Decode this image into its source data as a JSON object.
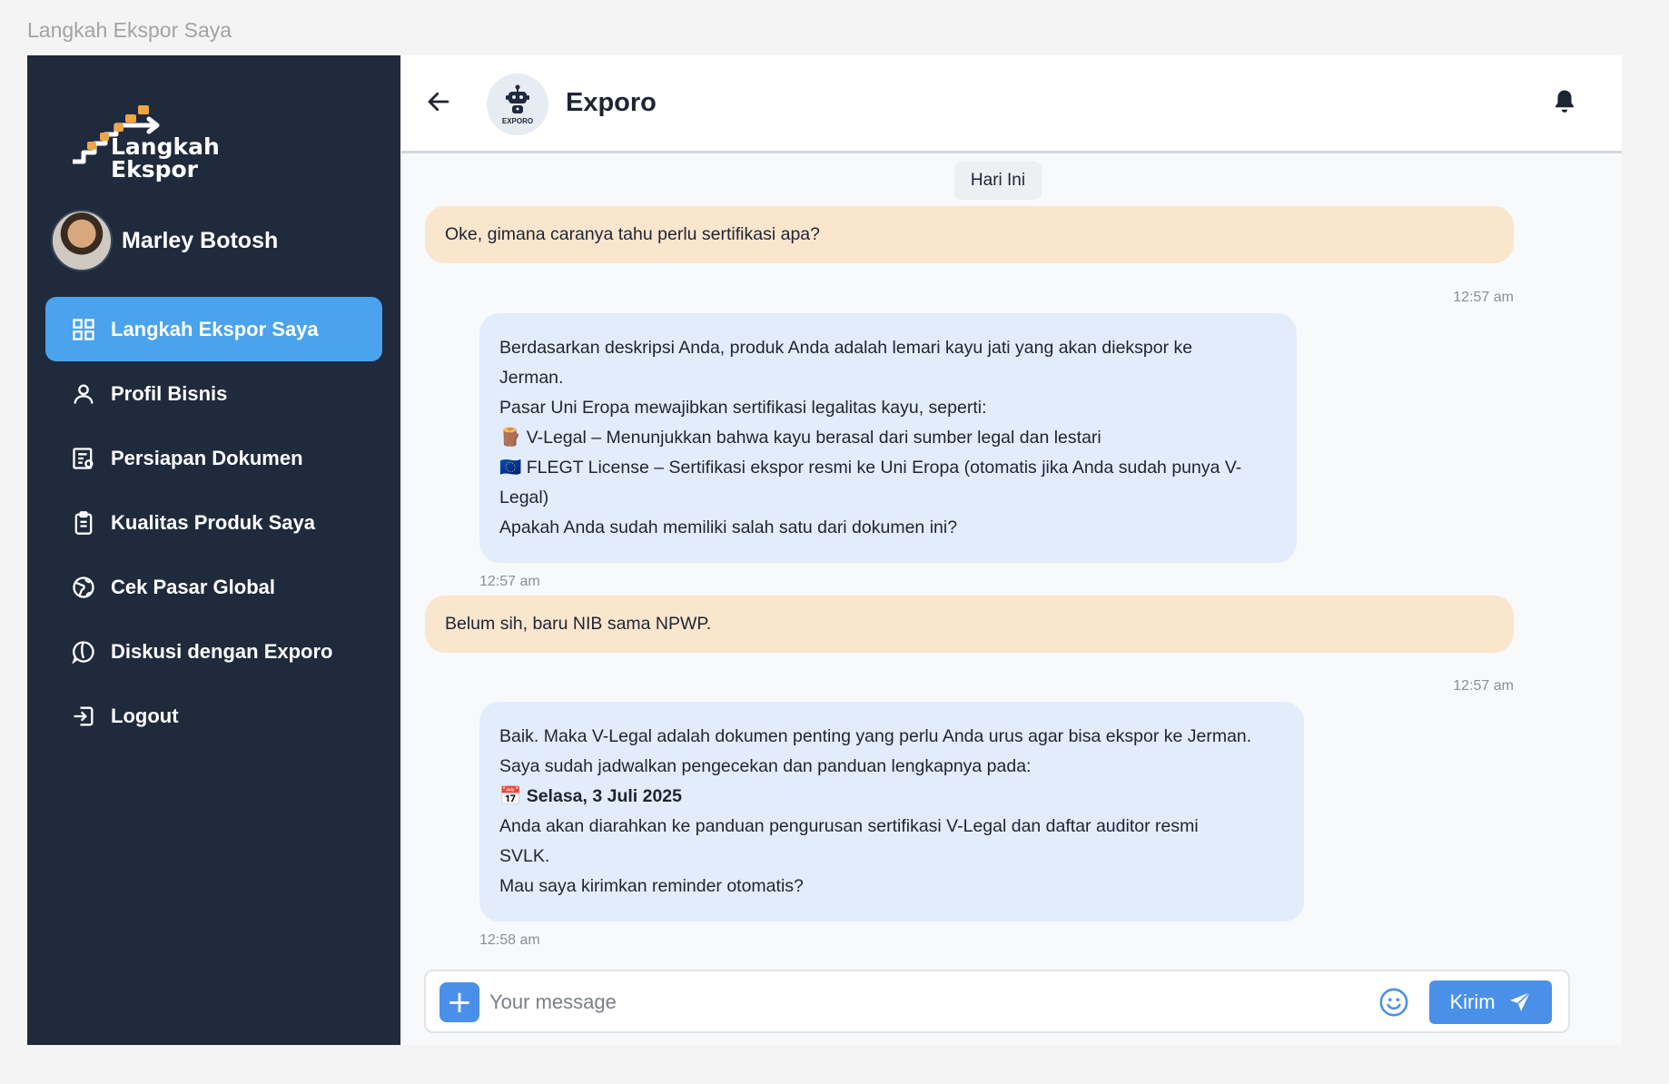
{
  "page_label": "Langkah Ekspor Saya",
  "sidebar": {
    "logo_line1": "Langkah",
    "logo_line2": "Ekspor",
    "user_name": "Marley Botosh",
    "items": [
      {
        "label": "Langkah Ekspor Saya",
        "icon": "grid-icon",
        "active": true
      },
      {
        "label": "Profil Bisnis",
        "icon": "user-icon"
      },
      {
        "label": "Persiapan Dokumen",
        "icon": "document-icon"
      },
      {
        "label": "Kualitas Produk Saya",
        "icon": "clipboard-icon"
      },
      {
        "label": "Cek Pasar Global",
        "icon": "globe-icon"
      },
      {
        "label": "Diskusi dengan Exporo",
        "icon": "chat-icon"
      },
      {
        "label": "Logout",
        "icon": "logout-icon"
      }
    ]
  },
  "header": {
    "bot_caption": "EXPORO",
    "bot_name": "Exporo"
  },
  "chat": {
    "date_chip": "Hari Ini",
    "messages": [
      {
        "from": "user",
        "lines": [
          "Oke, gimana caranya tahu perlu sertifikasi apa?"
        ],
        "time": "12:57 am"
      },
      {
        "from": "bot",
        "lines": [
          "Berdasarkan deskripsi Anda, produk Anda adalah lemari kayu jati yang akan diekspor ke",
          "Jerman.",
          "Pasar Uni Eropa mewajibkan sertifikasi legalitas kayu, seperti:",
          "🪵 V-Legal – Menunjukkan bahwa kayu berasal dari sumber legal dan lestari",
          "🇪🇺 FLEGT License – Sertifikasi ekspor resmi ke Uni Eropa (otomatis jika Anda sudah punya V-",
          "Legal)",
          "Apakah Anda sudah memiliki salah satu dari dokumen ini?"
        ],
        "time": "12:57 am"
      },
      {
        "from": "user",
        "lines": [
          "Belum sih, baru NIB sama NPWP."
        ],
        "time": "12:57 am"
      },
      {
        "from": "bot",
        "lines": [
          "Baik. Maka V-Legal adalah dokumen penting yang perlu Anda urus agar bisa ekspor ke Jerman.",
          "Saya sudah jadwalkan pengecekan dan panduan lengkapnya pada:",
          "📅 ",
          "Anda akan diarahkan ke panduan pengurusan sertifikasi V-Legal dan daftar auditor resmi",
          "SVLK.",
          "Mau saya kirimkan reminder otomatis?"
        ],
        "bold_date": "Selasa, 3 Juli 2025",
        "time": "12:58 am"
      }
    ]
  },
  "composer": {
    "plus_label": "+",
    "placeholder": "Your message",
    "send_label": "Kirim"
  },
  "colors": {
    "sidebar_bg": "#1f2a3c",
    "active_item": "#4aa3ec",
    "user_bubble": "#fae6cd",
    "bot_bubble": "#e3ecfb",
    "accent": "#4a90e9"
  }
}
